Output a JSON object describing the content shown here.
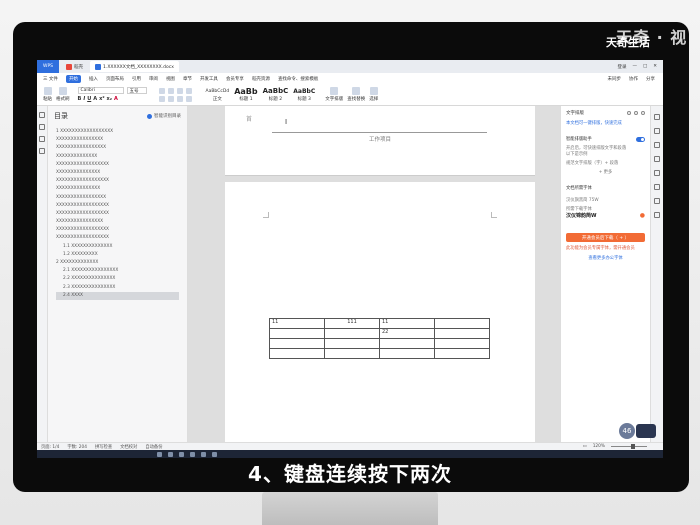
{
  "watermark": {
    "brand": "天奇生活",
    "brand_partial": "天奇 · 视"
  },
  "window": {
    "app_button": "WPS",
    "tabs": [
      {
        "label": "稻壳",
        "color": "#e8463a"
      },
      {
        "label": "1.XXXXXX文档_XXXXXXXX.docx",
        "color": "#2f6fde"
      }
    ],
    "right_controls": [
      "登录",
      "—",
      "□",
      "✕"
    ]
  },
  "menu": {
    "items": [
      "三 文件",
      "开始",
      "插入",
      "页面布局",
      "引用",
      "审阅",
      "视图",
      "章节",
      "开发工具",
      "会员专享",
      "稻壳资源",
      "查找命令、搜索模板"
    ],
    "active": "开始",
    "right": [
      "未同步",
      "协作",
      "分享"
    ]
  },
  "ribbon": {
    "paste_label": "粘贴",
    "format_painter": "格式刷",
    "font_name": "Calibri",
    "font_size": "五号",
    "format_buttons": [
      "B",
      "I",
      "U",
      "A",
      "x²",
      "x₂",
      "A"
    ],
    "styles": [
      {
        "preview": "AaBbCcDd",
        "label": "正文"
      },
      {
        "preview": "AaBb",
        "label": "标题 1"
      },
      {
        "preview": "AaBbC",
        "label": "标题 2"
      },
      {
        "preview": "AaBbC",
        "label": "标题 3"
      }
    ],
    "text_tools": "文字排版",
    "find_replace": "查找替换",
    "select": "选择"
  },
  "outline": {
    "title": "目录",
    "smart_label": "智能识别目录",
    "items": [
      {
        "text": "1 XXXXXXXXXXXXXXXXXX",
        "level": 1
      },
      {
        "text": "XXXXXXXXXXXXXXXX",
        "level": 1
      },
      {
        "text": "XXXXXXXXXXXXXXXXX",
        "level": 1
      },
      {
        "text": "XXXXXXXXXXXXXX",
        "level": 1
      },
      {
        "text": "XXXXXXXXXXXXXXXXXX",
        "level": 1
      },
      {
        "text": "XXXXXXXXXXXXXXX",
        "level": 1
      },
      {
        "text": "XXXXXXXXXXXXXXXXXX",
        "level": 1
      },
      {
        "text": "XXXXXXXXXXXXXXX",
        "level": 1
      },
      {
        "text": "XXXXXXXXXXXXXXXXX",
        "level": 1
      },
      {
        "text": "XXXXXXXXXXXXXXXXXX",
        "level": 1
      },
      {
        "text": "XXXXXXXXXXXXXXXXXX",
        "level": 1
      },
      {
        "text": "XXXXXXXXXXXXXXXX",
        "level": 1
      },
      {
        "text": "XXXXXXXXXXXXXXXXXX",
        "level": 1
      },
      {
        "text": "XXXXXXXXXXXXXXXXXX",
        "level": 1
      },
      {
        "text": "1.1 XXXXXXXXXXXXXX",
        "level": 2
      },
      {
        "text": "1.2 XXXXXXXXX",
        "level": 2
      },
      {
        "text": "2 XXXXXXXXXXXXX",
        "level": 1
      },
      {
        "text": "2.1 XXXXXXXXXXXXXXXX",
        "level": 2
      },
      {
        "text": "2.2 XXXXXXXXXXXXXXX",
        "level": 2
      },
      {
        "text": "2.3 XXXXXXXXXXXXXXX",
        "level": 2
      },
      {
        "text": "2.4 XXXX",
        "level": 2,
        "selected": true
      }
    ]
  },
  "document": {
    "header_text": "工作项目",
    "page_mark": "首",
    "table": [
      [
        "11",
        "111",
        "11",
        ""
      ],
      [
        "",
        "",
        "22",
        ""
      ],
      [
        "",
        "",
        "",
        ""
      ],
      [
        "",
        "",
        "",
        ""
      ]
    ]
  },
  "right_panel": {
    "title": "文字排版",
    "link": "本文档可一键排版，快速完成",
    "setting_label": "智能排版助手",
    "setting_desc": "开启后，可快速排版文字和段落",
    "setting_desc2": "以下是示例",
    "sample_label": "规范文字排版（字）+ 段落",
    "more": "+ 更多",
    "font_section": "文档所需字体",
    "font_item_1": "汉仪旗黑简 75W",
    "font_item_2": "所需下载字体",
    "font_item_bold": "汉仪锦韵简W",
    "download_button": "开通会员后下载（ + ）",
    "note": "此功能为会员专属字体，需开通会员",
    "vip_link": "查看更多办公字体"
  },
  "status": {
    "pages": "页面: 1/4",
    "words": "字数: 204",
    "spell": "拼写检查",
    "compat": "文档校对",
    "backup": "自动备份",
    "zoom": "120%"
  },
  "badge": "46",
  "caption": "4、键盘连续按下两次"
}
